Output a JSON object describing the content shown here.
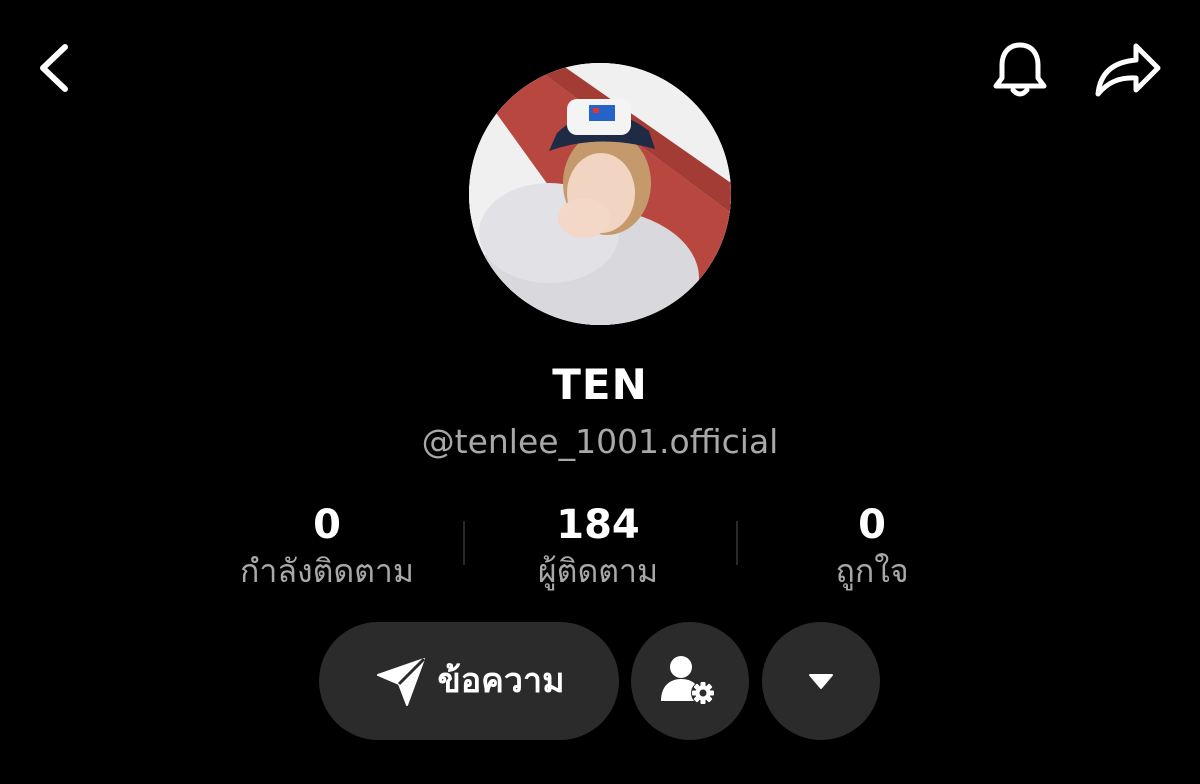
{
  "header": {
    "back_icon": "chevron-left-icon",
    "bell_icon": "bell-icon",
    "share_icon": "share-arrow-icon"
  },
  "profile": {
    "display_name": "TEN",
    "username": "@tenlee_1001.official"
  },
  "stats": [
    {
      "value": "0",
      "label": "กำลังติดตาม"
    },
    {
      "value": "184",
      "label": "ผู้ติดตาม"
    },
    {
      "value": "0",
      "label": "ถูกใจ"
    }
  ],
  "actions": {
    "message_label": "ข้อความ",
    "message_icon": "paper-plane-icon",
    "manage_icon": "user-gear-icon",
    "more_icon": "caret-down-icon"
  },
  "colors": {
    "background": "#000000",
    "button_bg": "#2b2b2b",
    "secondary_text": "#a8a8a8",
    "primary_text": "#ffffff"
  }
}
